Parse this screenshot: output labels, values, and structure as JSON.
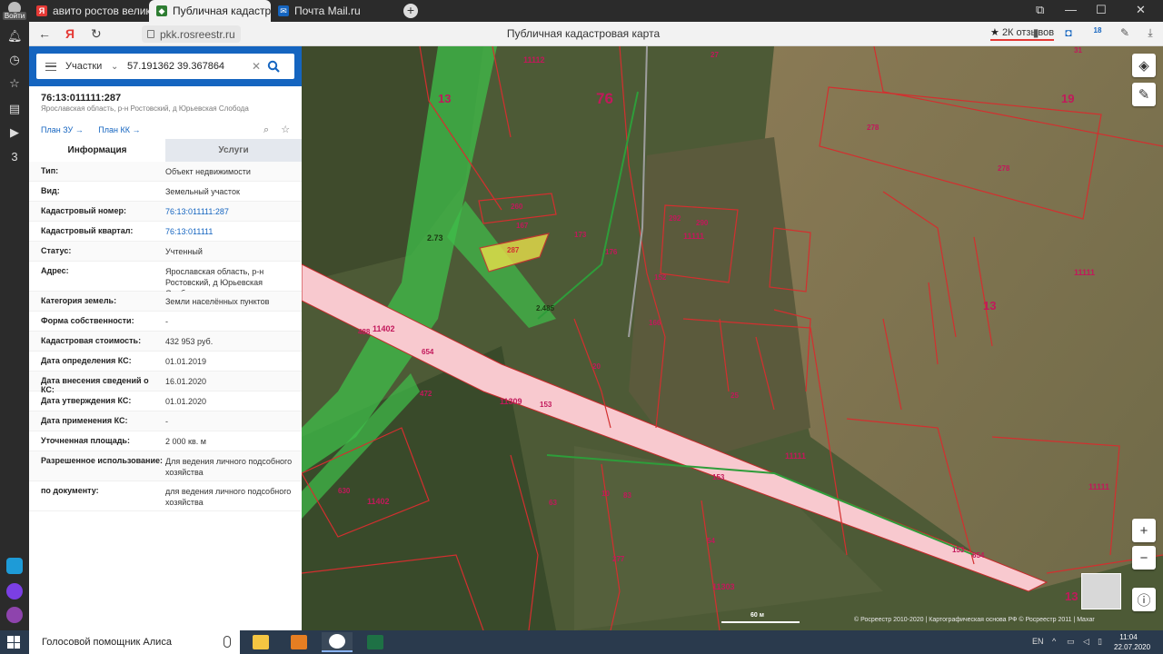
{
  "browser": {
    "account_label": "Войти",
    "tabs": [
      {
        "label": "авито ростов великий —",
        "active": false
      },
      {
        "label": "Публичная кадастрова",
        "active": true
      },
      {
        "label": "Почта Mail.ru",
        "active": false
      }
    ],
    "url": "pkk.rosreestr.ru",
    "page_title": "Публичная кадастровая карта",
    "reviews": "2К отзывов",
    "counter_badge": "18"
  },
  "search": {
    "type": "Участки",
    "query": "57.191362 39.367864"
  },
  "object": {
    "cadastral_number": "76:13:011111:287",
    "address_short": "Ярославская область, р-н Ростовский, д Юрьевская Слобода",
    "links": [
      "План ЗУ →",
      "План КК →"
    ],
    "tabs": [
      {
        "label": "Информация",
        "active": true
      },
      {
        "label": "Услуги",
        "active": false
      }
    ],
    "fields": [
      {
        "key": "Тип:",
        "value": "Объект недвижимости",
        "link": false
      },
      {
        "key": "Вид:",
        "value": "Земельный участок",
        "link": false
      },
      {
        "key": "Кадастровый номер:",
        "value": "76:13:011111:287",
        "link": true
      },
      {
        "key": "Кадастровый квартал:",
        "value": "76:13:011111",
        "link": true
      },
      {
        "key": "Статус:",
        "value": "Учтенный",
        "link": false
      },
      {
        "key": "Адрес:",
        "value": "Ярославская область, р-н Ростовский, д Юрьевская Слобода",
        "link": false
      },
      {
        "key": "Категория земель:",
        "value": "Земли населённых пунктов",
        "link": false
      },
      {
        "key": "Форма собственности:",
        "value": "-",
        "link": false
      },
      {
        "key": "Кадастровая стоимость:",
        "value": "432 953 руб.",
        "link": false
      },
      {
        "key": "Дата определения КС:",
        "value": "01.01.2019",
        "link": false
      },
      {
        "key": "Дата внесения сведений о КС:",
        "value": "16.01.2020",
        "link": false
      },
      {
        "key": "Дата утверждения КС:",
        "value": "01.01.2020",
        "link": false
      },
      {
        "key": "Дата применения КС:",
        "value": "-",
        "link": false
      },
      {
        "key": "Уточненная площадь:",
        "value": "2 000 кв. м",
        "link": false
      },
      {
        "key": "Разрешенное использование:",
        "value": "Для ведения личного подсобного хозяйства",
        "link": false
      },
      {
        "key": "по документу:",
        "value": "для ведения личного подсобного хозяйства",
        "link": false
      }
    ]
  },
  "map": {
    "labels": [
      "11112",
      "13",
      "76",
      "27",
      "31",
      "19",
      "278",
      "278",
      "11111",
      "13",
      "260",
      "167",
      "287",
      "173",
      "176",
      "292",
      "290",
      "11111",
      "2.73",
      "2.485",
      "152",
      "166",
      "488",
      "11402",
      "654",
      "153",
      "11309",
      "472",
      "20",
      "25",
      "11111",
      "153",
      "630",
      "11402",
      "63",
      "10",
      "83",
      "277",
      "54",
      "11303",
      "153",
      "654",
      "11111",
      "13"
    ],
    "scale": "60 м",
    "attribution": "© Росреестр 2010-2020 | Картографическая основа РФ © Росреестр 2011 | Maxar"
  },
  "taskbar": {
    "assistant": "Голосовой помощник Алиса",
    "lang": "EN",
    "time": "11:04",
    "date": "22.07.2020"
  },
  "colors": {
    "brand_blue": "#1565c0",
    "parcel_line": "#d32f2f",
    "road_fill": "#f8c9cf",
    "green_zone": "#3fbf4a",
    "selected_parcel": "#e8e04a"
  }
}
